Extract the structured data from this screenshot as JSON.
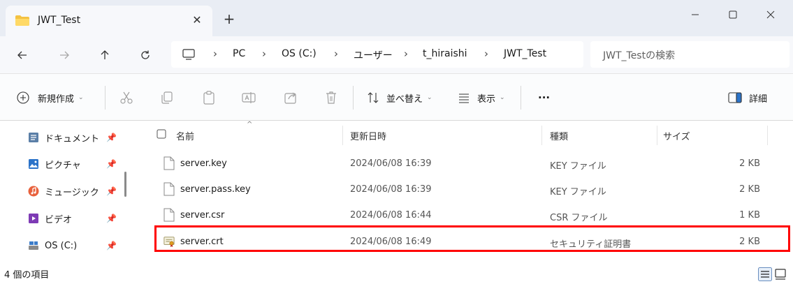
{
  "window": {
    "tab_title": "JWT_Test",
    "close_tab": "✕",
    "new_tab": "+"
  },
  "address": {
    "crumbs": [
      "PC",
      "OS (C:)",
      "ユーザー",
      "t_hiraishi",
      "JWT_Test"
    ],
    "separator": "›",
    "search_placeholder": "JWT_Testの検索"
  },
  "toolbar": {
    "new_label": "新規作成",
    "sort_label": "並べ替え",
    "view_label": "表示",
    "more_label": "···",
    "details_label": "詳細"
  },
  "sidebar": {
    "items": [
      {
        "label": "ドキュメント",
        "icon": "documents-icon",
        "color": "#5b7fa7"
      },
      {
        "label": "ピクチャ",
        "icon": "pictures-icon",
        "color": "#2b73c9"
      },
      {
        "label": "ミュージック",
        "icon": "music-icon",
        "color": "#e8613c"
      },
      {
        "label": "ビデオ",
        "icon": "videos-icon",
        "color": "#7e3bb5"
      },
      {
        "label": "OS (C:)",
        "icon": "drive-icon",
        "color": "#3d7dca"
      }
    ]
  },
  "columns": {
    "name": "名前",
    "modified": "更新日時",
    "type": "種類",
    "size": "サイズ"
  },
  "files": [
    {
      "name": "server.key",
      "modified": "2024/06/08 16:39",
      "type": "KEY ファイル",
      "size": "2 KB",
      "icon": "file-icon"
    },
    {
      "name": "server.pass.key",
      "modified": "2024/06/08 16:39",
      "type": "KEY ファイル",
      "size": "2 KB",
      "icon": "file-icon"
    },
    {
      "name": "server.csr",
      "modified": "2024/06/08 16:44",
      "type": "CSR ファイル",
      "size": "1 KB",
      "icon": "file-icon"
    },
    {
      "name": "server.crt",
      "modified": "2024/06/08 16:49",
      "type": "セキュリティ証明書",
      "size": "2 KB",
      "icon": "certificate-icon"
    }
  ],
  "status": {
    "item_count": "4 個の項目"
  },
  "colors": {
    "highlight": "#ff0000",
    "titlebar_bg": "#e9edf4",
    "folder": "#f4c242"
  }
}
